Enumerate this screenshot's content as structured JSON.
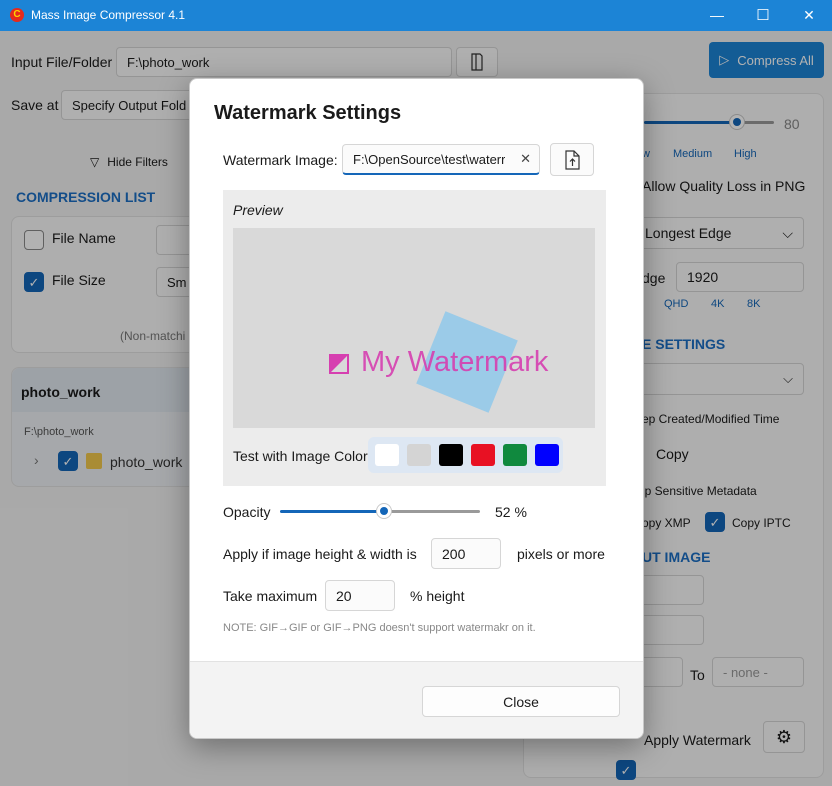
{
  "window": {
    "title": "Mass Image Compressor 4.1",
    "app_icon_glyph": "C",
    "minimize": "—",
    "maximize": "☐",
    "close": "✕"
  },
  "toolbar": {
    "compress_all": "Compress All",
    "play_glyph": "▷"
  },
  "input": {
    "label": "Input File/Folder",
    "value": "F:\\photo_work"
  },
  "save": {
    "label": "Save at",
    "value": "Specify Output Fold"
  },
  "filters": {
    "hide_label": "Hide Filters",
    "filter_glyph": "▽"
  },
  "compression_list": {
    "title": "COMPRESSION LIST",
    "file_name_label": "File Name",
    "file_size_label": "File Size",
    "file_size_value": "Sm",
    "non_matching": "(Non-matchi"
  },
  "folder": {
    "name": "photo_work",
    "path": "F:\\photo_work",
    "item": "photo_work",
    "chevron": "›"
  },
  "quality": {
    "value": "80",
    "low": "w",
    "medium": "Medium",
    "high": "High",
    "allow_loss_png": "Allow Quality Loss in PNG"
  },
  "resize": {
    "mode": "Longest Edge",
    "edge_label": "dge",
    "edge_value": "1920",
    "qhd": "QHD",
    "k4": "4K",
    "k8": "8K"
  },
  "settings_section": {
    "title": "E SETTINGS",
    "keep_time": "ep Created/Modified Time",
    "copy": "Copy",
    "strip": "ip Sensitive Metadata",
    "copy_xmp": "opy XMP",
    "copy_iptc": "Copy IPTC"
  },
  "output_section": {
    "title": "UT IMAGE",
    "to": "To",
    "none_placeholder": "- none -"
  },
  "apply_watermark": {
    "label": "Apply Watermark",
    "gear_glyph": "⚙"
  },
  "dialog": {
    "title": "Watermark Settings",
    "image_label": "Watermark Image:",
    "image_value": "F:\\OpenSource\\test\\waterr",
    "clear_glyph": "✕",
    "preview_title": "Preview",
    "watermark_text": "My Watermark",
    "test_color_label": "Test with Image Color",
    "swatches": [
      "#ffffff",
      "#d4d4d4",
      "#000000",
      "#e81123",
      "#10893e",
      "#0000ff"
    ],
    "opacity_label": "Opacity",
    "opacity_value": 52,
    "opacity_text": "52 %",
    "apply_label": "Apply if image height & width is",
    "apply_value": "200",
    "apply_suffix": "pixels or more",
    "max_label": "Take maximum",
    "max_value": "20",
    "max_suffix": "% height",
    "note": "NOTE: GIF→GIF or GIF→PNG doesn't support watermakr on it.",
    "close_label": "Close"
  },
  "colors": {
    "accent": "#1c84d6",
    "title_blue": "#1c6fc4",
    "watermark_pink": "#d63fb0",
    "watermark_blue_shape": "#8fc8ea"
  }
}
